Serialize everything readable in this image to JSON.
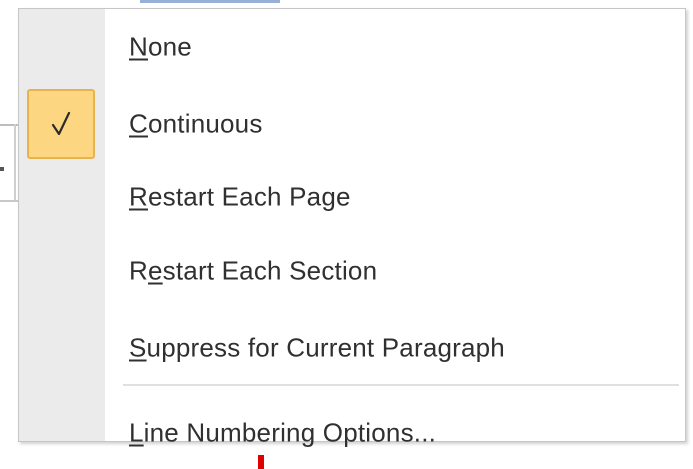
{
  "menu": {
    "items": [
      {
        "pre": "",
        "ul": "N",
        "post": "one",
        "checked": false
      },
      {
        "pre": "",
        "ul": "C",
        "post": "ontinuous",
        "checked": true
      },
      {
        "pre": "",
        "ul": "R",
        "post": "estart Each Page",
        "checked": false
      },
      {
        "pre": "R",
        "ul": "e",
        "post": "start Each Section",
        "checked": false
      },
      {
        "pre": "",
        "ul": "S",
        "post": "uppress for Current Paragraph",
        "checked": false
      },
      {
        "pre": "",
        "ul": "L",
        "post": "ine Numbering Options...",
        "checked": false
      }
    ],
    "check_icon": "checkmark-icon",
    "colors": {
      "check_highlight": "#fcd680",
      "check_border": "#e8b24d",
      "gutter": "#ebebeb",
      "text": "#303030"
    }
  }
}
